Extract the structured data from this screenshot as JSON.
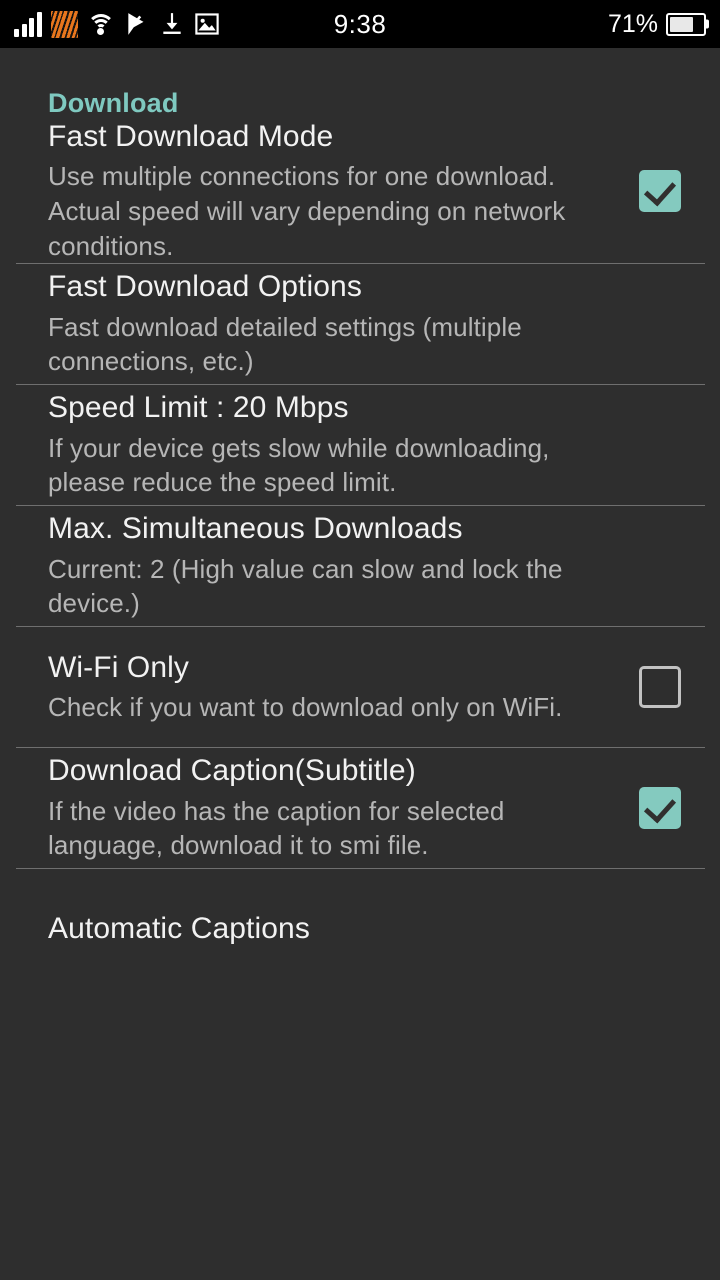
{
  "status_bar": {
    "time": "9:38",
    "battery_percent": "71%",
    "battery_level": 71,
    "icons": [
      "signal-bars-icon",
      "tiger-stripe-icon",
      "wifi-icon",
      "flag-check-icon",
      "download-arrow-icon",
      "image-icon"
    ]
  },
  "colors": {
    "background": "#2e2e2e",
    "accent_teal": "#7fc9c0",
    "checkbox_checked": "#84cabf",
    "title_text": "#f2f2f2",
    "summary_text": "#b6b6b6",
    "divider": "#6f6f6f",
    "status_bar_bg": "#000000"
  },
  "section": {
    "header": "Download"
  },
  "preferences": [
    {
      "title": "Fast Download Mode",
      "summary": "Use multiple connections for one download. Actual speed will vary depending on network conditions.",
      "widget": "checkbox",
      "checked": true
    },
    {
      "title": "Fast Download Options",
      "summary": "Fast download detailed settings (multiple connections, etc.)",
      "widget": "none",
      "checked": null
    },
    {
      "title": "Speed Limit : 20 Mbps",
      "summary": "If your device gets slow while downloading, please reduce the speed limit.",
      "widget": "none",
      "checked": null
    },
    {
      "title": "Max. Simultaneous Downloads",
      "summary": "Current: 2 (High value can slow and lock the device.)",
      "widget": "none",
      "checked": null
    },
    {
      "title": "Wi-Fi Only",
      "summary": "Check if you want to download only on WiFi.",
      "widget": "checkbox",
      "checked": false
    },
    {
      "title": "Download Caption(Subtitle)",
      "summary": "If the video has the caption for selected language, download it to smi file.",
      "widget": "checkbox",
      "checked": true
    },
    {
      "title": "Automatic Captions",
      "summary": "",
      "widget": "none",
      "checked": null
    }
  ]
}
